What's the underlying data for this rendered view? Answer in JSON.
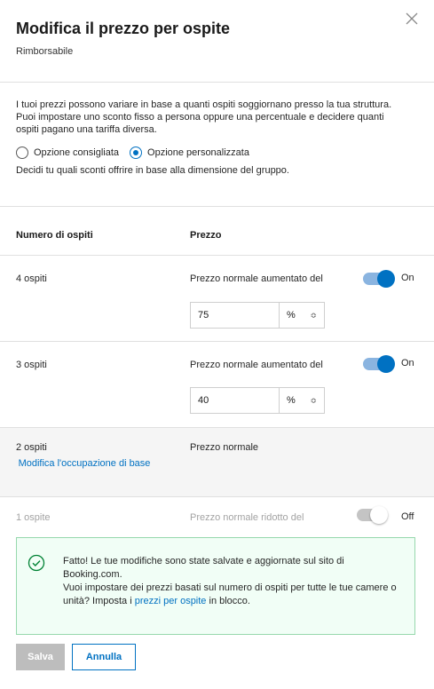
{
  "dialog": {
    "title": "Modifica il prezzo per ospite",
    "subtitle": "Rimborsabile",
    "description": "I tuoi prezzi possono variare in base a quanti ospiti soggiornano presso la tua struttura. Puoi impostare uno sconto fisso a persona oppure una percentuale e decidere quanti ospiti pagano una tariffa diversa.",
    "options": {
      "recommended": "Opzione consigliata",
      "custom": "Opzione personalizzata",
      "selected": "custom"
    },
    "hint": "Decidi tu quali sconti offrire in base alla dimensione del gruppo."
  },
  "table": {
    "headers": {
      "guests": "Numero di ospiti",
      "price": "Prezzo"
    },
    "rows": [
      {
        "guests": "4 ospiti",
        "price_label": "Prezzo normale aumentato del",
        "value": "75",
        "unit": "%",
        "toggle": "On"
      },
      {
        "guests": "3 ospiti",
        "price_label": "Prezzo normale aumentato del",
        "value": "40",
        "unit": "%",
        "toggle": "On"
      },
      {
        "guests": "2 ospiti",
        "link": "Modifica l'occupazione di base",
        "price_label": "Prezzo normale"
      },
      {
        "guests": "1 ospite",
        "price_label": "Prezzo normale ridotto del",
        "toggle": "Off"
      }
    ]
  },
  "success": {
    "line1": "Fatto! Le tue modifiche sono state salvate e aggiornate sul sito di Booking.com.",
    "line2_pre": "Vuoi impostare dei prezzi basati sul numero di ospiti per tutte le tue camere o unità? Imposta i ",
    "line2_link": "prezzi per ospite",
    "line2_post": " in blocco."
  },
  "buttons": {
    "save": "Salva",
    "cancel": "Annulla"
  },
  "colors": {
    "accent": "#0071c2",
    "success_border": "#97d8ad",
    "success_bg": "#f1fef6"
  }
}
